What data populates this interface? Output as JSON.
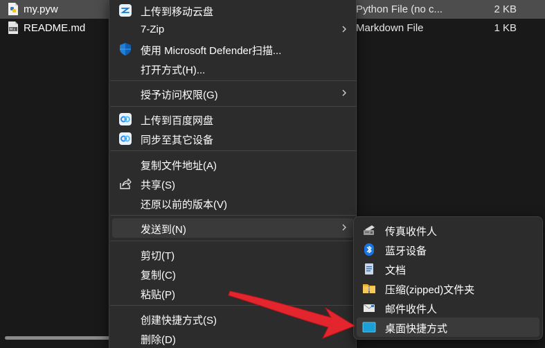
{
  "files": [
    {
      "name": "my.pyw",
      "type": "Python File (no c...",
      "size": "2 KB",
      "icon": "python-file-icon",
      "selected": true
    },
    {
      "name": "README.md",
      "type": "Markdown File",
      "size": "1 KB",
      "icon": "markdown-file-icon",
      "selected": false
    }
  ],
  "context_menu": {
    "items": [
      {
        "label": "上传到移动云盘",
        "icon": "cloud-drive-icon"
      },
      {
        "label": "7-Zip",
        "submenu": true
      },
      {
        "label": "使用 Microsoft Defender扫描...",
        "icon": "defender-shield-icon"
      },
      {
        "label": "打开方式(H)..."
      },
      {
        "label": "授予访问权限(G)",
        "submenu": true
      },
      {
        "label": "上传到百度网盘",
        "icon": "baidu-netdisk-icon"
      },
      {
        "label": "同步至其它设备",
        "icon": "baidu-sync-icon"
      },
      {
        "label": "复制文件地址(A)"
      },
      {
        "label": "共享(S)",
        "icon": "share-icon"
      },
      {
        "label": "还原以前的版本(V)"
      },
      {
        "label": "发送到(N)",
        "submenu": true,
        "hover": true
      },
      {
        "label": "剪切(T)"
      },
      {
        "label": "复制(C)"
      },
      {
        "label": "粘贴(P)"
      },
      {
        "label": "创建快捷方式(S)"
      },
      {
        "label": "删除(D)"
      }
    ]
  },
  "send_to_menu": {
    "items": [
      {
        "label": "传真收件人",
        "icon": "fax-icon"
      },
      {
        "label": "蓝牙设备",
        "icon": "bluetooth-icon"
      },
      {
        "label": "文档",
        "icon": "documents-icon"
      },
      {
        "label": "压缩(zipped)文件夹",
        "icon": "zip-folder-icon"
      },
      {
        "label": "邮件收件人",
        "icon": "mail-recipient-icon"
      },
      {
        "label": "桌面快捷方式",
        "icon": "desktop-shortcut-icon",
        "hover": true
      }
    ]
  },
  "colors": {
    "background": "#191919",
    "menu": "#2c2c2c",
    "hover": "#3a3a3a",
    "selected_row": "#4d4d4d",
    "annotation_arrow": "#e3262e",
    "accent_blue": "#0a6fd6"
  }
}
